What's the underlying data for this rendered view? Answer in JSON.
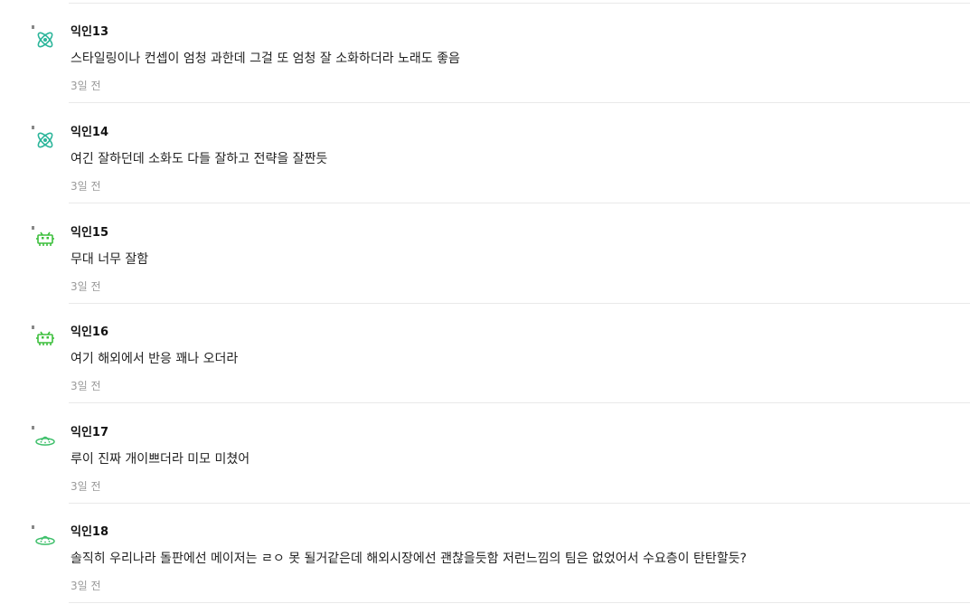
{
  "comments": [
    {
      "nickname": "익인13",
      "text": "스타일링이나 컨셉이 엄청 과한데 그걸 또 엄청 잘 소화하더라 노래도 좋음",
      "time": "3일 전",
      "icon": "atom-icon",
      "icon_color": "#2bb59a"
    },
    {
      "nickname": "익인14",
      "text": "여긴 잘하던데 소화도 다들 잘하고 전략을 잘짠듯",
      "time": "3일 전",
      "icon": "atom-icon",
      "icon_color": "#2bb59a"
    },
    {
      "nickname": "익인15",
      "text": "무대 너무 잘함",
      "time": "3일 전",
      "icon": "space-invader-icon",
      "icon_color": "#3dbf3d"
    },
    {
      "nickname": "익인16",
      "text": "여기 해외에서 반응 꽤나 오더라",
      "time": "3일 전",
      "icon": "space-invader-icon",
      "icon_color": "#3dbf3d"
    },
    {
      "nickname": "익인17",
      "text": "루이 진짜 개이쁘더라 미모 미쳤어",
      "time": "3일 전",
      "icon": "ufo-icon",
      "icon_color": "#3dbf6a"
    },
    {
      "nickname": "익인18",
      "text": "솔직히 우리나라 돌판에선 메이저는 ㄹㅇ 못 될거같은데 해외시장에선 괜찮을듯함 저런느낌의 팀은 없었어서 수요층이 탄탄할듯?",
      "time": "3일 전",
      "icon": "ufo-icon",
      "icon_color": "#3dbf6a"
    }
  ]
}
